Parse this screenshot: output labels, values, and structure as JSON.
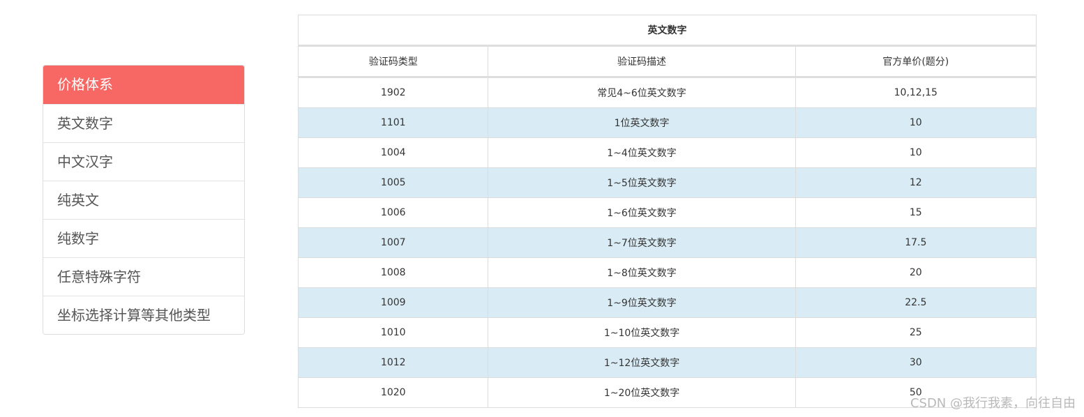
{
  "sidebar": {
    "header": "价格体系",
    "items": [
      {
        "label": "英文数字"
      },
      {
        "label": "中文汉字"
      },
      {
        "label": "纯英文"
      },
      {
        "label": "纯数字"
      },
      {
        "label": "任意特殊字符"
      },
      {
        "label": "坐标选择计算等其他类型"
      }
    ]
  },
  "table": {
    "title": "英文数字",
    "columns": [
      "验证码类型",
      "验证码描述",
      "官方单价(题分)"
    ],
    "rows": [
      [
        "1902",
        "常见4~6位英文数字",
        "10,12,15"
      ],
      [
        "1101",
        "1位英文数字",
        "10"
      ],
      [
        "1004",
        "1~4位英文数字",
        "10"
      ],
      [
        "1005",
        "1~5位英文数字",
        "12"
      ],
      [
        "1006",
        "1~6位英文数字",
        "15"
      ],
      [
        "1007",
        "1~7位英文数字",
        "17.5"
      ],
      [
        "1008",
        "1~8位英文数字",
        "20"
      ],
      [
        "1009",
        "1~9位英文数字",
        "22.5"
      ],
      [
        "1010",
        "1~10位英文数字",
        "25"
      ],
      [
        "1012",
        "1~12位英文数字",
        "30"
      ],
      [
        "1020",
        "1~20位英文数字",
        "50"
      ]
    ]
  },
  "colors": {
    "accent": "#f76864",
    "stripe": "#d9ecf5"
  },
  "watermark": "CSDN @我行我素，向往自由"
}
